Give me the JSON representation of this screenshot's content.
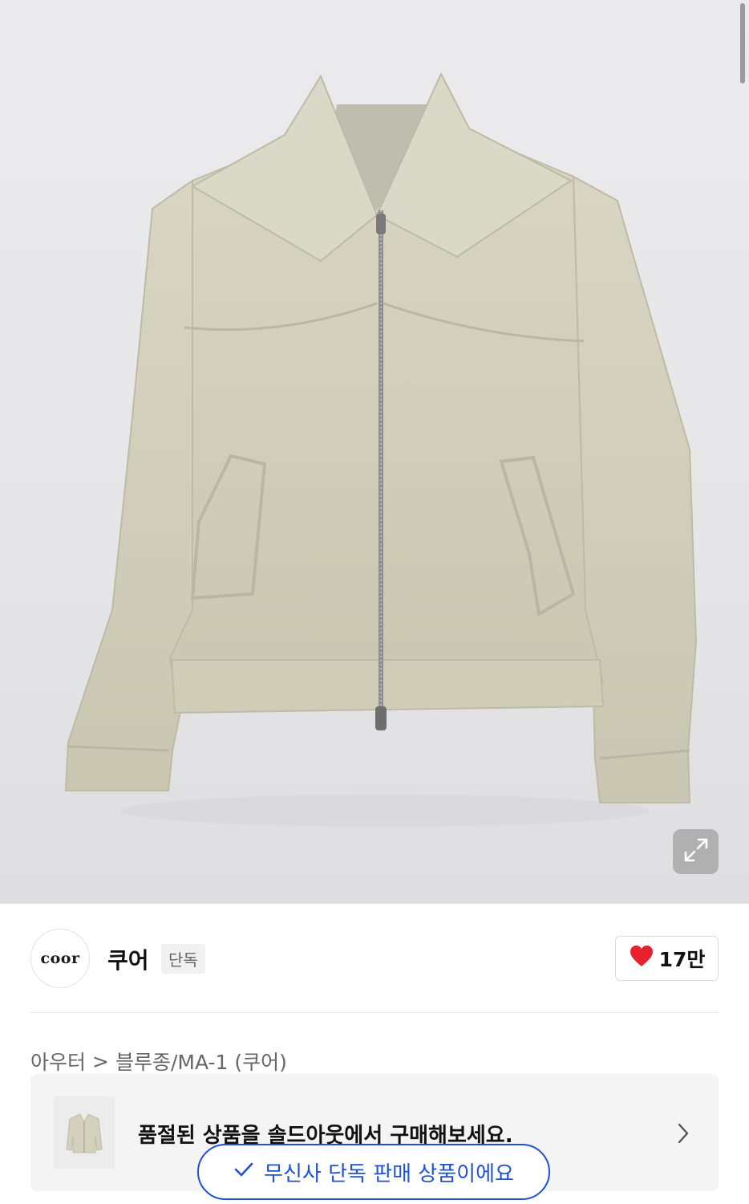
{
  "product": {
    "image_alt": "beige cotton blouson jacket"
  },
  "brand": {
    "logo_text": "coor",
    "name": "쿠어",
    "badge": "단독"
  },
  "like": {
    "count": "17만",
    "icon": "heart-icon",
    "color": "#e8222c"
  },
  "breadcrumb": {
    "category": "아우터",
    "separator": ">",
    "subcategory": "블루종/MA-1 (쿠어)"
  },
  "soldout_banner": {
    "text": "품절된 상품을 솔드아웃에서 구매해보세요.",
    "chevron": "chevron-right-icon"
  },
  "toast": {
    "text": "무신사 단독 판매 상품이에요",
    "icon": "check-icon",
    "color": "#1e50d8"
  }
}
